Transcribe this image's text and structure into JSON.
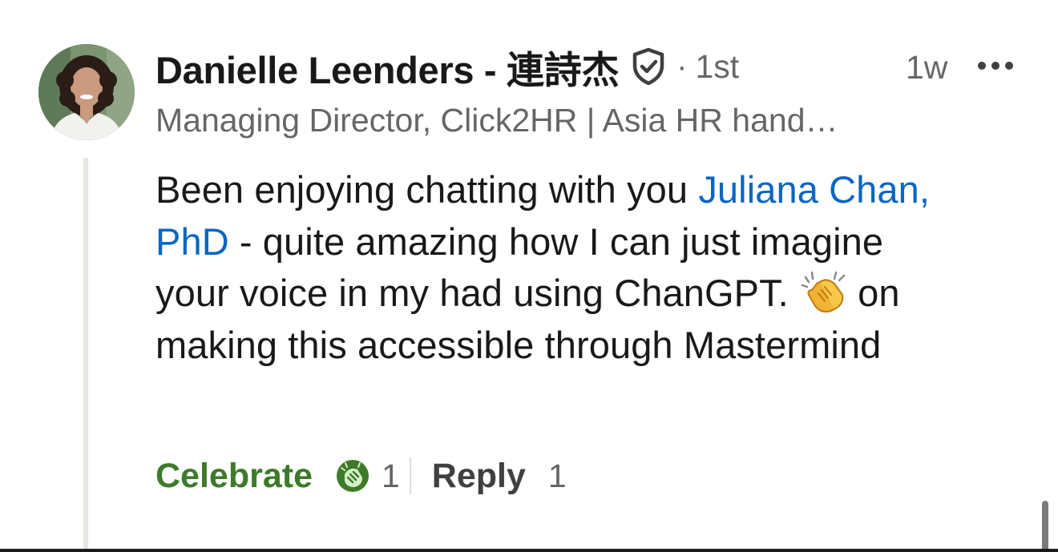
{
  "comment": {
    "author": {
      "name": "Danielle Leenders - 連詩杰",
      "degree": "1st",
      "separator": "·",
      "headline": "Managing Director, Click2HR | Asia HR hand…",
      "avatar_icon": "avatar-photo",
      "verified_icon": "shield-check-icon"
    },
    "timestamp": "1w",
    "more_icon": "more-options-icon",
    "body": {
      "text_before_mention": "Been enjoying chatting with you ",
      "mention": "Juliana Chan, PhD",
      "text_after_mention": " - quite amazing how I can just imagine your voice in my had using ChanGPT. ",
      "emoji": "clapping-hands-emoji",
      "text_after_emoji": " on making this accessible through Mastermind"
    },
    "actions": {
      "reaction_label": "Celebrate",
      "reaction_icon": "celebrate-icon",
      "reaction_count": "1",
      "reply_label": "Reply",
      "reply_count": "1"
    }
  },
  "colors": {
    "mention": "#0a66c2",
    "celebrate": "#3d7a2a",
    "secondary_text": "#666666",
    "primary_text": "#191919"
  }
}
